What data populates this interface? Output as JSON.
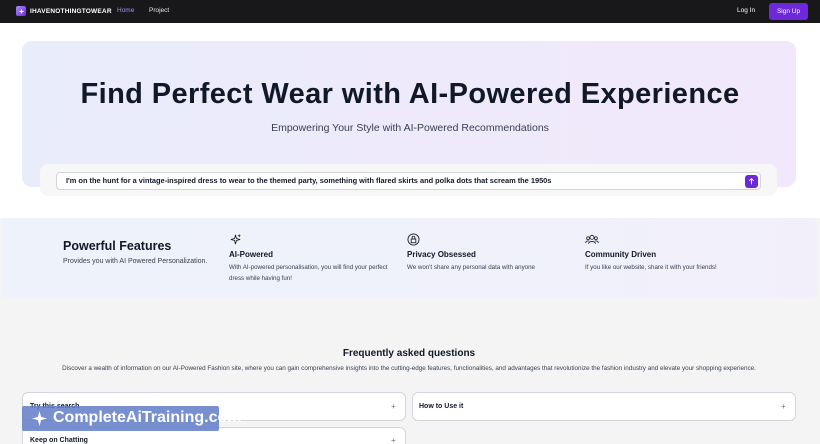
{
  "nav": {
    "brand": "IHAVENOTHINGTOWEAR",
    "links": [
      "Home",
      "Project"
    ],
    "login": "Log In",
    "signup": "Sign Up"
  },
  "hero": {
    "title": "Find Perfect Wear with AI-Powered Experience",
    "subtitle": "Empowering Your Style with AI-Powered Recommendations"
  },
  "search": {
    "value": "I'm on the hunt for a vintage-inspired dress to wear to the themed party, something with flared skirts and polka dots that scream the 1950s"
  },
  "features": {
    "title": "Powerful Features",
    "subtitle": "Provides you with AI Powered Personalization.",
    "items": [
      {
        "icon": "sparkle-icon",
        "name": "AI-Powered",
        "desc": "With AI-powered personalisation, you will find your perfect dress while having fun!"
      },
      {
        "icon": "lock-shield-icon",
        "name": "Privacy Obsessed",
        "desc": "We won't share any personal data with anyone"
      },
      {
        "icon": "users-icon",
        "name": "Community Driven",
        "desc": "If you like our website, share it with your friends!"
      }
    ]
  },
  "faq": {
    "title": "Frequently asked questions",
    "subtitle": "Discover a wealth of information on our AI-Powered Fashion site, where you can gain comprehensive insights into the cutting-edge features, functionalities, and advantages that revolutionize the fashion industry and elevate your shopping experience.",
    "items": [
      "Try this search",
      "How to Use it",
      "Keep on Chatting"
    ],
    "expand_symbol": "+"
  },
  "watermark": "CompleteAiTraining.com",
  "colors": {
    "accent": "#6d28d9",
    "navbar": "#18181b"
  }
}
